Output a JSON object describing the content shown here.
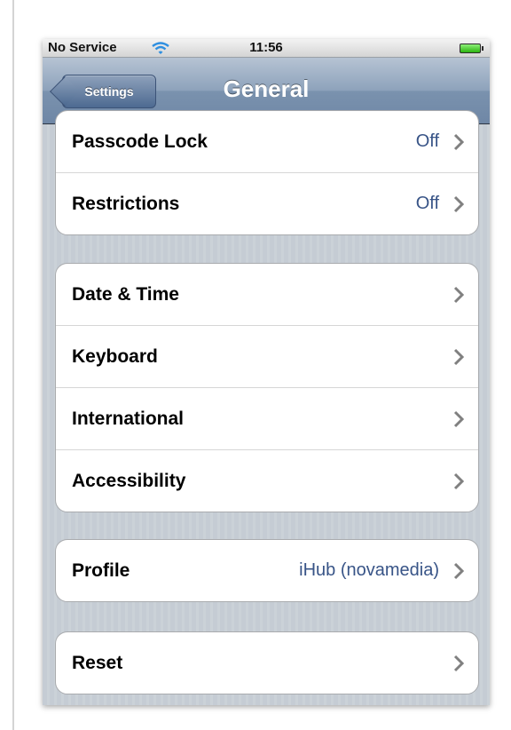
{
  "status_bar": {
    "carrier": "No Service",
    "time": "11:56",
    "wifi_icon": "wifi-icon",
    "battery_icon": "battery-icon"
  },
  "nav": {
    "back_label": "Settings",
    "title": "General"
  },
  "groups": [
    {
      "rows": [
        {
          "label": "Passcode Lock",
          "value": "Off"
        },
        {
          "label": "Restrictions",
          "value": "Off"
        }
      ]
    },
    {
      "rows": [
        {
          "label": "Date & Time",
          "value": ""
        },
        {
          "label": "Keyboard",
          "value": ""
        },
        {
          "label": "International",
          "value": ""
        },
        {
          "label": "Accessibility",
          "value": ""
        }
      ]
    },
    {
      "rows": [
        {
          "label": "Profile",
          "value": "iHub (novamedia)"
        }
      ]
    },
    {
      "rows": [
        {
          "label": "Reset",
          "value": ""
        }
      ]
    }
  ],
  "colors": {
    "value_text": "#385487",
    "nav_bar": "#7a92ae",
    "background_stripe": "#c5ccd4"
  }
}
